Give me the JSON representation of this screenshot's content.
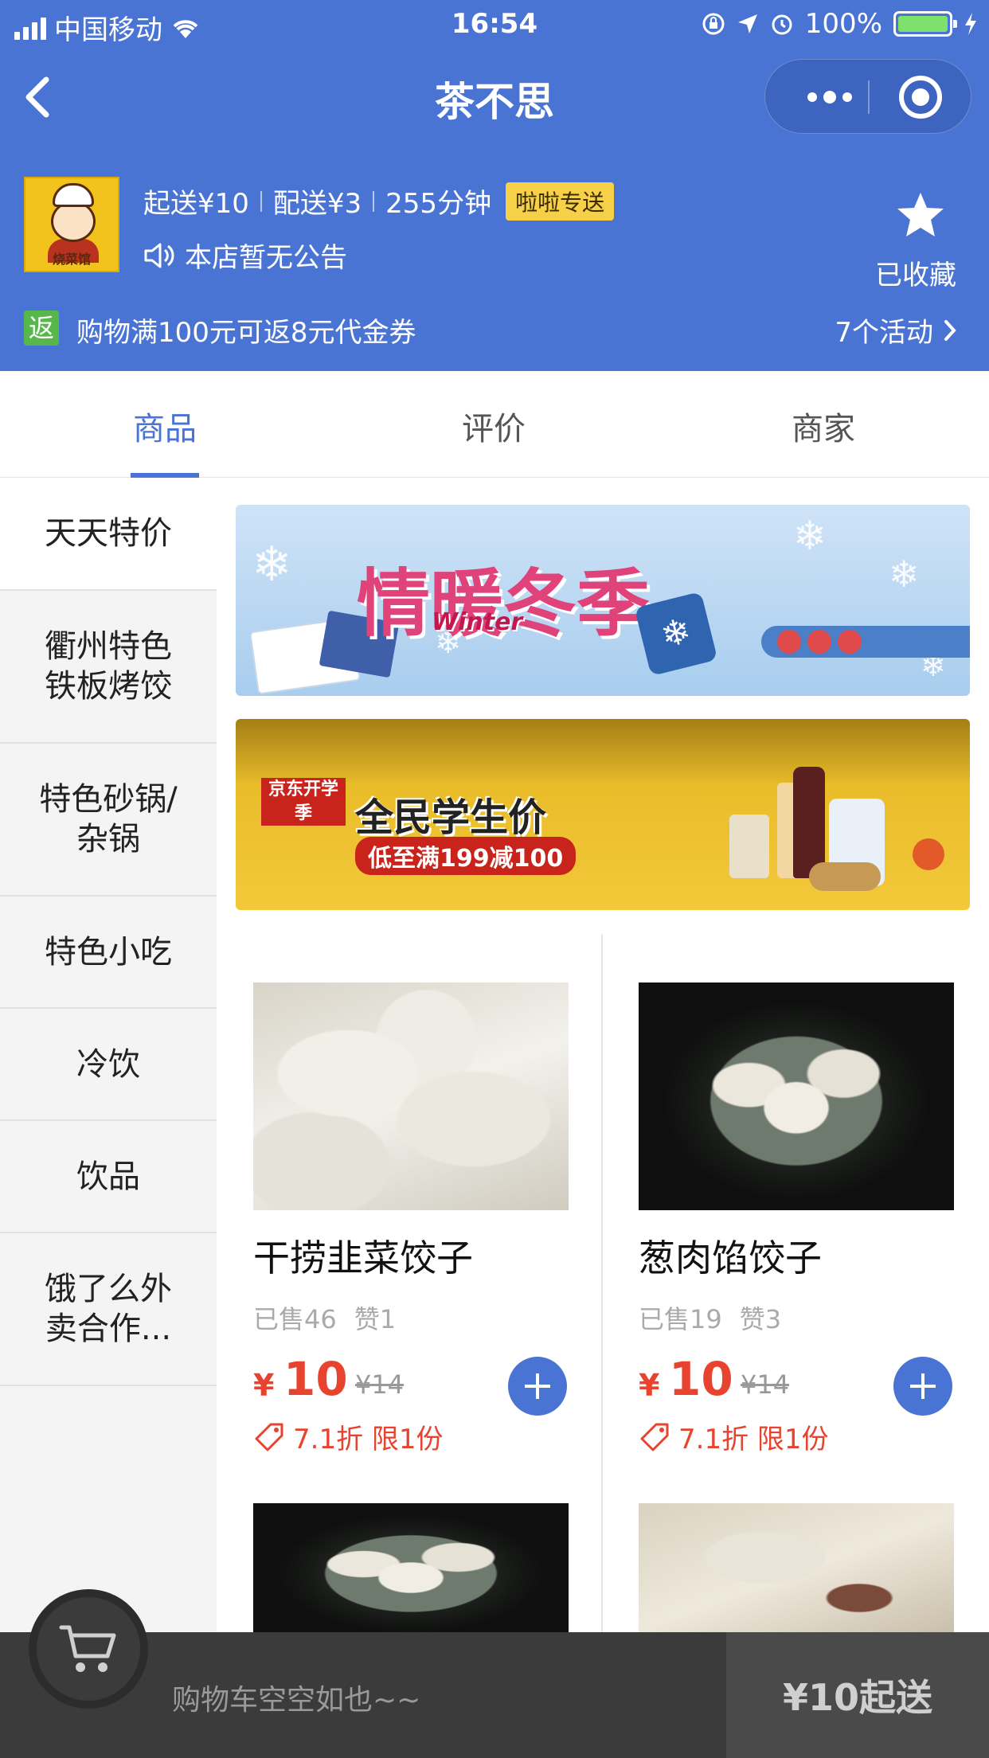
{
  "status_bar": {
    "carrier": "中国移动",
    "time": "16:54",
    "battery": "100%"
  },
  "nav": {
    "title": "茶不思"
  },
  "shop": {
    "logo_text": "烧菜馆",
    "min_order": "起送¥10",
    "delivery_fee": "配送¥3",
    "delivery_time": "255分钟",
    "delivery_badge": "啦啦专送",
    "notice": "本店暂无公告",
    "favorite_label": "已收藏"
  },
  "promo": {
    "icon_text": "返",
    "text": "购物满100元可返8元代金券",
    "more": "7个活动"
  },
  "tabs": [
    {
      "label": "商品"
    },
    {
      "label": "评价"
    },
    {
      "label": "商家"
    }
  ],
  "categories": [
    {
      "label": "天天特价"
    },
    {
      "label": "衢州特色铁板烤饺"
    },
    {
      "label": "特色砂锅/杂锅"
    },
    {
      "label": "特色小吃"
    },
    {
      "label": "冷饮"
    },
    {
      "label": "饮品"
    },
    {
      "label": "饿了么外卖合作..."
    }
  ],
  "banners": {
    "winter": {
      "title": "情暖冬季",
      "subtitle": "Winter"
    },
    "student": {
      "brand": "京东开学季",
      "title": "全民学生价",
      "subtitle": "低至满199减100"
    }
  },
  "products": [
    {
      "name": "干捞韭菜饺子",
      "sold": "已售46",
      "likes": "赞1",
      "currency": "¥",
      "price": "10",
      "original": "¥14",
      "discount": "7.1折 限1份"
    },
    {
      "name": "葱肉馅饺子",
      "sold": "已售19",
      "likes": "赞3",
      "currency": "¥",
      "price": "10",
      "original": "¥14",
      "discount": "7.1折 限1份"
    }
  ],
  "cart": {
    "empty_text": "购物车空空如也~~",
    "min_label": "¥10起送"
  },
  "colors": {
    "primary": "#4a74d3",
    "price": "#e8432f",
    "badge": "#f6d046",
    "cart_bar": "#3b3b3b"
  }
}
